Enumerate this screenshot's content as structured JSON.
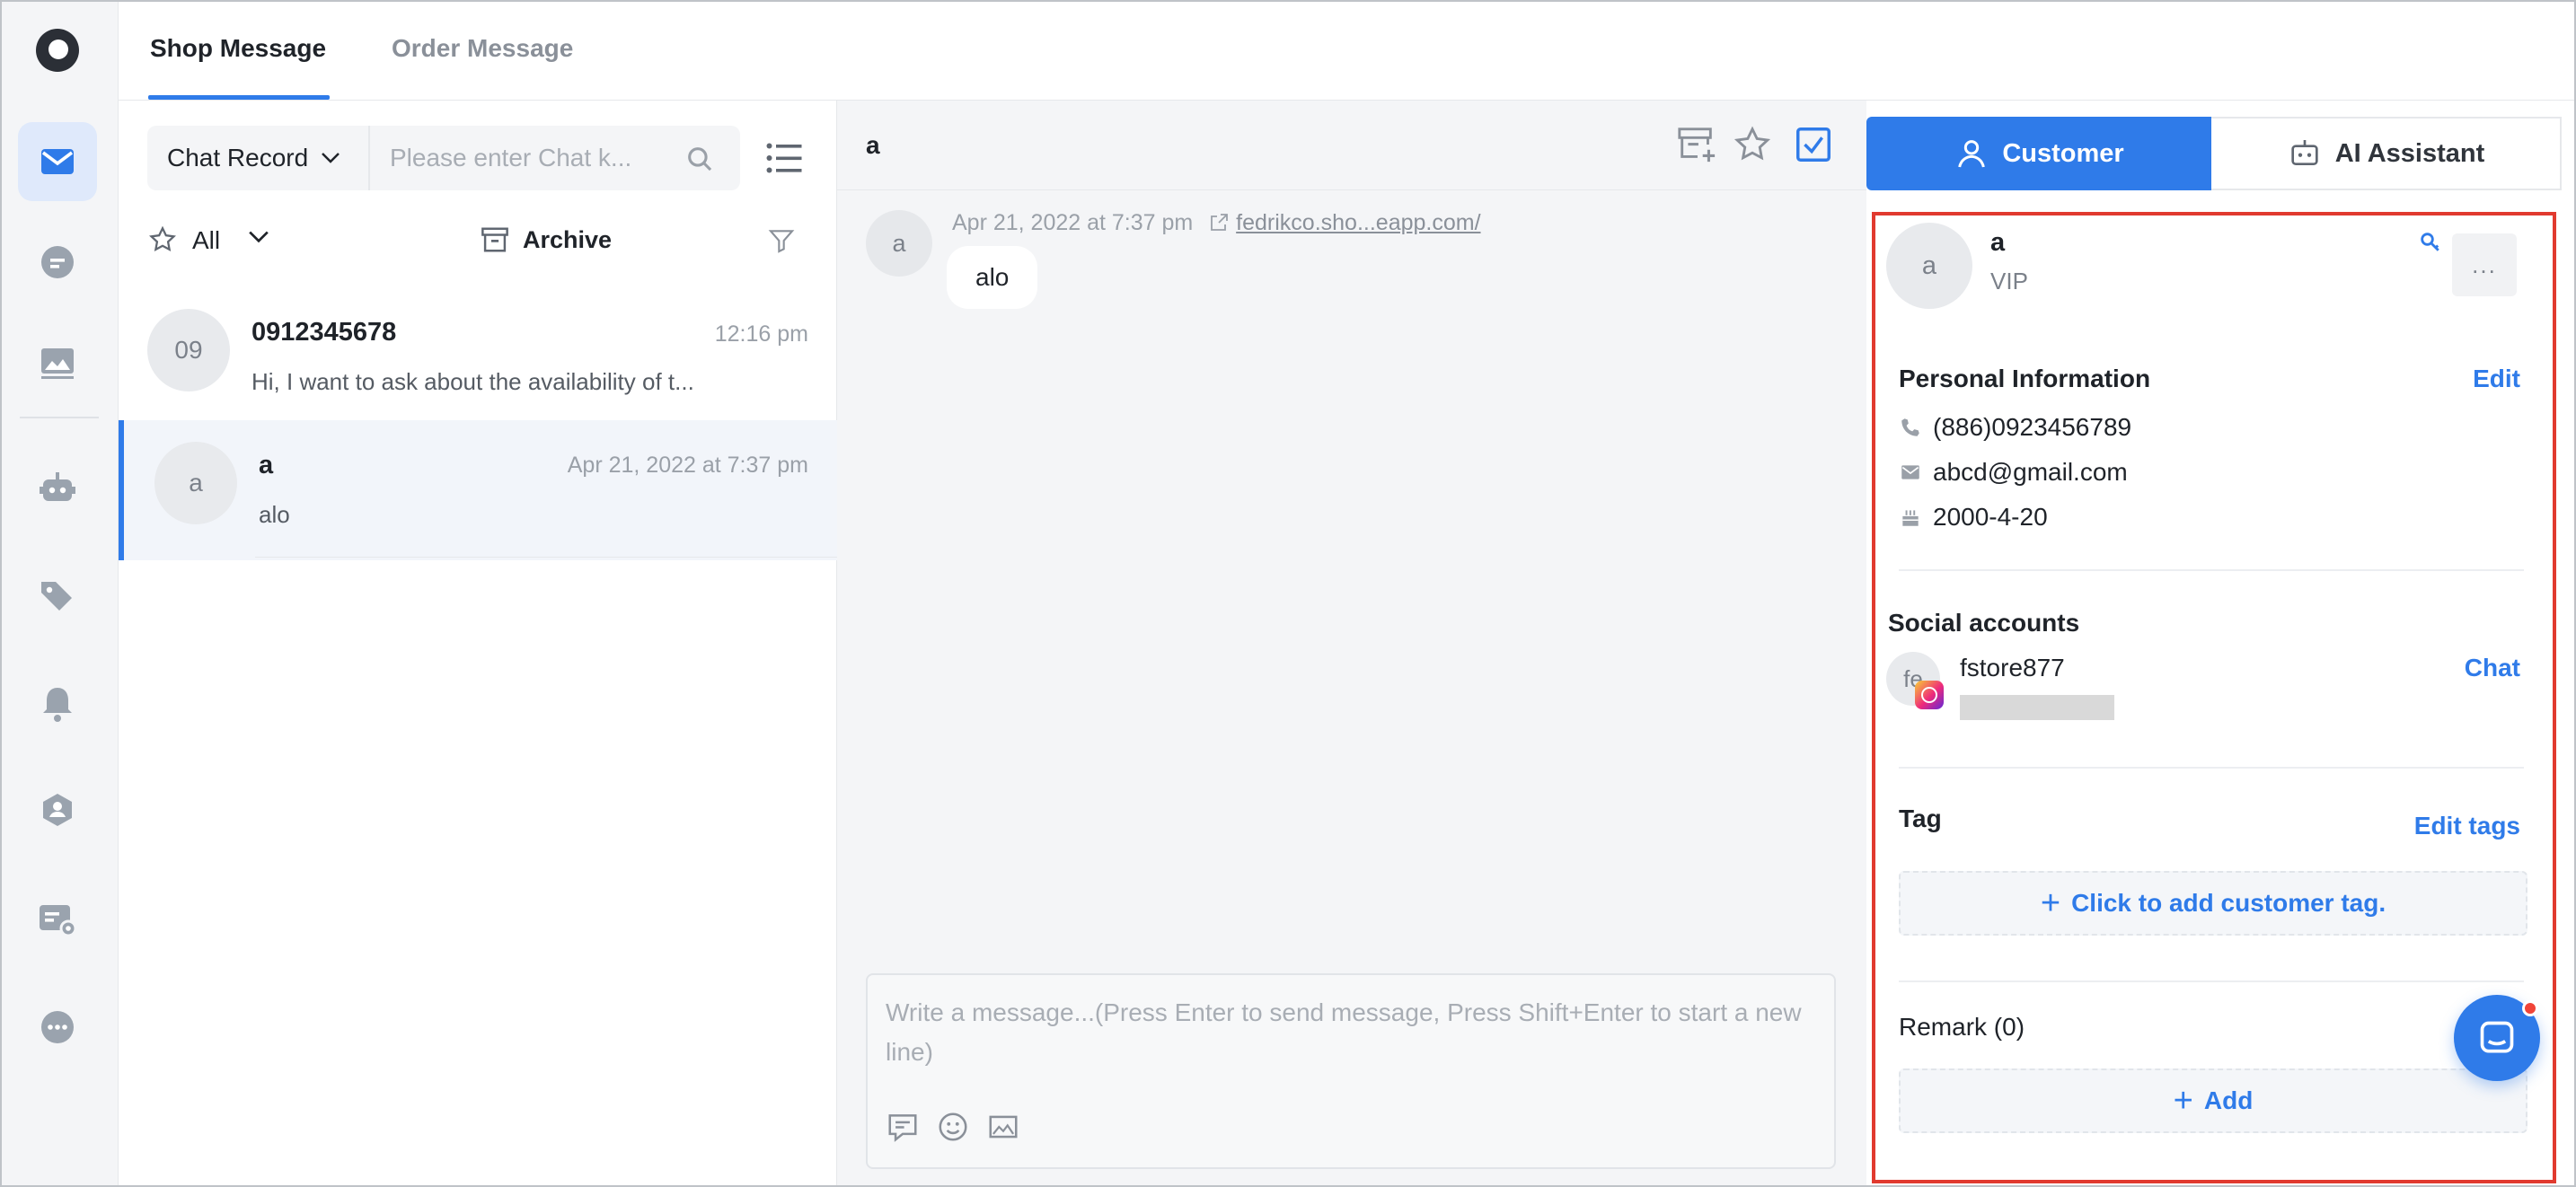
{
  "top_tabs": [
    {
      "label": "Shop Message",
      "active": true
    },
    {
      "label": "Order Message",
      "active": false
    }
  ],
  "rail": {
    "items": [
      "mail-icon",
      "chat-bubble-icon",
      "image-icon",
      "robot-icon",
      "tags-icon",
      "bell-icon",
      "user-shield-icon",
      "card-settings-icon",
      "more-icon"
    ],
    "active_index": 0
  },
  "search": {
    "scope_label": "Chat Record",
    "placeholder": "Please enter Chat k..."
  },
  "filters": {
    "all_label": "All",
    "archive_label": "Archive"
  },
  "conversations": [
    {
      "avatar": "09",
      "name": "0912345678",
      "time": "12:16 pm",
      "preview": "Hi, I want to ask about the availability of t...",
      "selected": false
    },
    {
      "avatar": "a",
      "name": "a",
      "time": "Apr 21, 2022 at 7:37 pm",
      "preview": "alo",
      "selected": true
    }
  ],
  "chat": {
    "title": "a",
    "message": {
      "avatar": "a",
      "timestamp": "Apr 21, 2022 at 7:37 pm",
      "link": "fedrikco.sho...eapp.com/",
      "text": "alo"
    },
    "composer_placeholder": "Write a message...(Press Enter to send message, Press Shift+Enter to start a new line)"
  },
  "side_tabs": {
    "customer": "Customer",
    "ai": "AI Assistant"
  },
  "customer": {
    "avatar": "a",
    "name": "a",
    "level": "VIP",
    "more": "...",
    "personal_title": "Personal Information",
    "edit_label": "Edit",
    "phone": "(886)0923456789",
    "email": "abcd@gmail.com",
    "birthday": "2000-4-20",
    "social_title": "Social accounts",
    "social_avatar": "fe",
    "social_name": "fstore877",
    "social_chat": "Chat",
    "tag_title": "Tag",
    "edit_tags": "Edit tags",
    "add_tag": "Click to add customer tag.",
    "remark_title": "Remark (0)",
    "add_label": "Add"
  },
  "colors": {
    "accent": "#2f7be9",
    "highlight_border": "#e13a2f"
  }
}
